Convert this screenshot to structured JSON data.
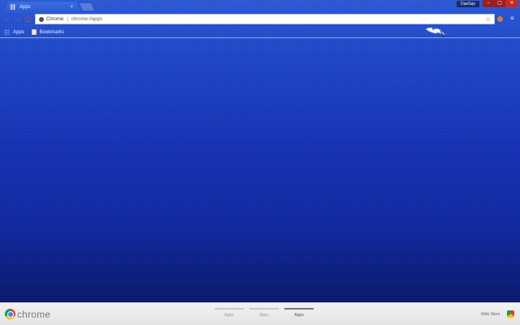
{
  "window": {
    "tab_title": "Apps",
    "tab_close": "×",
    "profile_name": "DaeSay",
    "minimize": "–",
    "maximize": "▢",
    "close": "✕"
  },
  "toolbar": {
    "back": "←",
    "forward": "→",
    "reload": "C",
    "omnibox_chip": "Chrome",
    "omnibox_sep": "|",
    "omnibox_url": "chrome://apps",
    "star": "☆",
    "menu": "≡"
  },
  "bookmarks": {
    "apps_label": "Apps",
    "folder_label": "Bookmarks"
  },
  "bottom": {
    "logo_text": "chrome",
    "pages": [
      {
        "label": "Apps"
      },
      {
        "label": "Apps"
      },
      {
        "label": "Apps"
      }
    ],
    "active_page": 3,
    "webstore_label": "Web Store"
  },
  "colors": {
    "accent_red": "#d8423a",
    "background_blue": "#1532b5"
  }
}
